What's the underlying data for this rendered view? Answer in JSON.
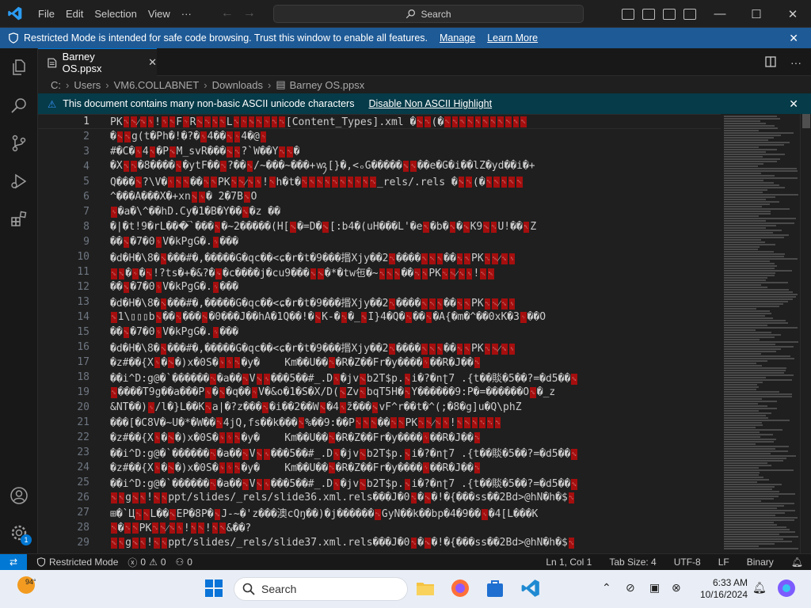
{
  "titlebar": {
    "menu": [
      "File",
      "Edit",
      "Selection",
      "View"
    ],
    "more": "···",
    "search_label": "Search",
    "back": "←",
    "forward": "→"
  },
  "restricted_banner": {
    "text": "Restricted Mode is intended for safe code browsing. Trust this window to enable all features.",
    "manage": "Manage",
    "learn_more": "Learn More",
    "close": "✕"
  },
  "tab": {
    "filename": "Barney OS.ppsx",
    "close": "✕"
  },
  "breadcrumb": [
    "C:",
    "Users",
    "VM6.COLLABNET",
    "Downloads",
    "Barney OS.ppsx"
  ],
  "ascii_banner": {
    "text": "This document contains many non-basic ASCII unicode characters",
    "action": "Disable Non ASCII Highlight",
    "close": "✕"
  },
  "editor": {
    "active_line": 1,
    "lines": [
      {
        "n": "1",
        "t": "PK␃␄⁄␆␈!␞␑F␋R␅␃␐␑L␐␋␁␃␋␂␃[Content_Types].xml �␅␃(�␑␂␀␀␀␀␀␀␀␀␀"
      },
      {
        "n": "2",
        "t": "�␄␃g(t�Ph�!�?�␈4��␂␋4�@␋"
      },
      {
        "n": "3",
        "t": "#�C�␈4␀�P␅M_svR���␅␃?`W��Y␃␂�"
      },
      {
        "n": "4",
        "t": "�X␂␃�8����␆�ytF��␃?��␃/~���~���+ꪃ[}�,<ₒG�����␁␆��e�G�i��lZ�yd��i�+"
      },
      {
        "n": "5",
        "t": "Q���␕?\\V�␏␀␀��␃␀PK␃␄⁄␆␈!␀h�t�␃␀␀␀␂␀␀␋␀␃_rels/.rels �␅␃(�␀␀␀␀␀"
      },
      {
        "n": "6",
        "t": "^���A���X�+xn␅␎� 2�7B␆O"
      },
      {
        "n": "7",
        "t": "␎�a�\\^��hD.Cy�1�B�Y��␆�z ��"
      },
      {
        "n": "8",
        "t": "�|�t!9�rL���͝`���␇�~2�����(H[␅�=D�␅[:b4�(uH���L'�e␇�b�␖�␅K9␅␃U!��␇Z"
      },
      {
        "n": "9",
        "t": "��␆�7�0␌V�kPgG�.␌���"
      },
      {
        "n": "10",
        "t": "�d�H�\\8�␖���#�,�����G�qc��<ɕ�r�t�9���㨉Xjy��2␃����␀␀␀��␃␀PK␃␄⁄␆␈"
      },
      {
        "n": "11",
        "t": "␛␆�␉�␃!?ts�+�&?�␙�c����j�cu9���␆␅�*�tw㐌�~␂␀␀��␃␀PK␃␄⁄␆␈!␀␀"
      },
      {
        "n": "12",
        "t": "��␆�7�0␌V�kPgG�.␌���"
      },
      {
        "n": "13",
        "t": "�d�H�\\8�␖���#�,�����G�qc��<ɕ�r�t�9���㨉Xjy��2␃����␀␀␀��␃␀PK␃␄⁄␆␈"
      },
      {
        "n": "14",
        "t": "␛1\\▯▯▯b␆��␃���␄�0���J��hA�1Q��!�␅K-�␃�_␆I}4�Q�␃��␃�Ã{�m�^��0xK�3␋��O"
      },
      {
        "n": "15",
        "t": "��␆�7�0␌V�kPgG�.␌���"
      },
      {
        "n": "16",
        "t": "�d�H�\\8�␖���#�,�����G�qc��<ɕ�r�t�9���㨉Xjy��2␃����␀␀␀��␃␀PK␃␄⁄␆␈"
      },
      {
        "n": "17",
        "t": "�z#��{X␎�␅�)x�0S�␍␌␃�y�    Kmֿ��U��␃�R�Z��Fr�y����␌��R�J��␃"
      },
      {
        "n": "18",
        "t": "��i^D:g@�`������␃�a��␃V␅␈���5��#_.D␈�jv␅b2T$p.␆i�?�nʈ7 .{t��賧�5��?=�d5��␆"
      },
      {
        "n": "19",
        "t": "␆����T9g��a���P␎�␖�q��␋V�&o�1�S�X/D(␅Zv␇bqT5H�␂Y������9:P�=������O␆�_z"
      },
      {
        "n": "20",
        "t": "&NT��)␎/l�}L��K␃a|�?z���␂�i��2��W␅�4␈z̃���␅vF^r��t�^(;�8�g]u�Q\\phŽ"
      },
      {
        "n": "21",
        "t": "���[�C8V�~U�*�W��␃4jQ,fs��k���␆%��9:��P␐␀␀��␃␀PK␃␄⁄␆␈!␀␀␀␐␃␂"
      },
      {
        "n": "22",
        "t": "�z#��{X␎�␅�)x�0S�␍␌␃�y�    Kmֿ��U��␃�R�Z��Fr�y����␌��R�J��␃"
      },
      {
        "n": "23",
        "t": "��i^D:g@�`������␃�a��␃V␅␈���5��#_.D␈�jv␅b2T$p.␆i�?�nʈ7 .{t��賧�5��?=�d5��␆"
      },
      {
        "n": "24",
        "t": "�z#��{X␎�␅�)x�0S�␍␌␃�y�    Kmֿ��U��␃�R�Z��Fr�y����␌��R�J��␃"
      },
      {
        "n": "25",
        "t": "��i^D:g@�`������␃�a��␃V␅␈���5��#_.D␈�jv␅b2T$p.␆i�?�nʈ7 .{t��賧�5��?=�d5��␆"
      },
      {
        "n": "26",
        "t": "␁␀g␅␀!␀␀ppt/slides/_rels/slide36.xml.rels���J�0␃�␅�!�{���ss��2Bd>@hN�h�$␃"
      },
      {
        "n": "27",
        "t": "⊞�`Ц␃␀L��␅EP�8P�␆J-~�'z���澳cQŋ��)�j������␃GyN��k��bp�4�9��␎�4[L���K"
      },
      {
        "n": "28",
        "t": "␀�␃␀PK␃␄⁄␆␈!␀␀!␀␀&��?"
      },
      {
        "n": "29",
        "t": "␁␀g␅␀!␀␀ppt/slides/_rels/slide37.xml.rels���J�0␃�␅�!�{���ss��2Bd>@hN�h�$␃"
      }
    ]
  },
  "statusbar": {
    "restricted": "Restricted Mode",
    "errors": "0",
    "warnings": "0",
    "ports": "0",
    "position": "Ln 1, Col 1",
    "tab_size": "Tab Size: 4",
    "encoding": "UTF-8",
    "eol": "LF",
    "language": "Binary"
  },
  "taskbar": {
    "temperature": "94°",
    "search_label": "Search",
    "time": "6:33 AM",
    "date": "10/16/2024"
  },
  "activity_badge": "1",
  "colors": {
    "accent": "#0078d4",
    "banner_blue": "#1e5a96",
    "ascii_banner": "#063b49",
    "control_char_bg": "#a50e0e"
  }
}
